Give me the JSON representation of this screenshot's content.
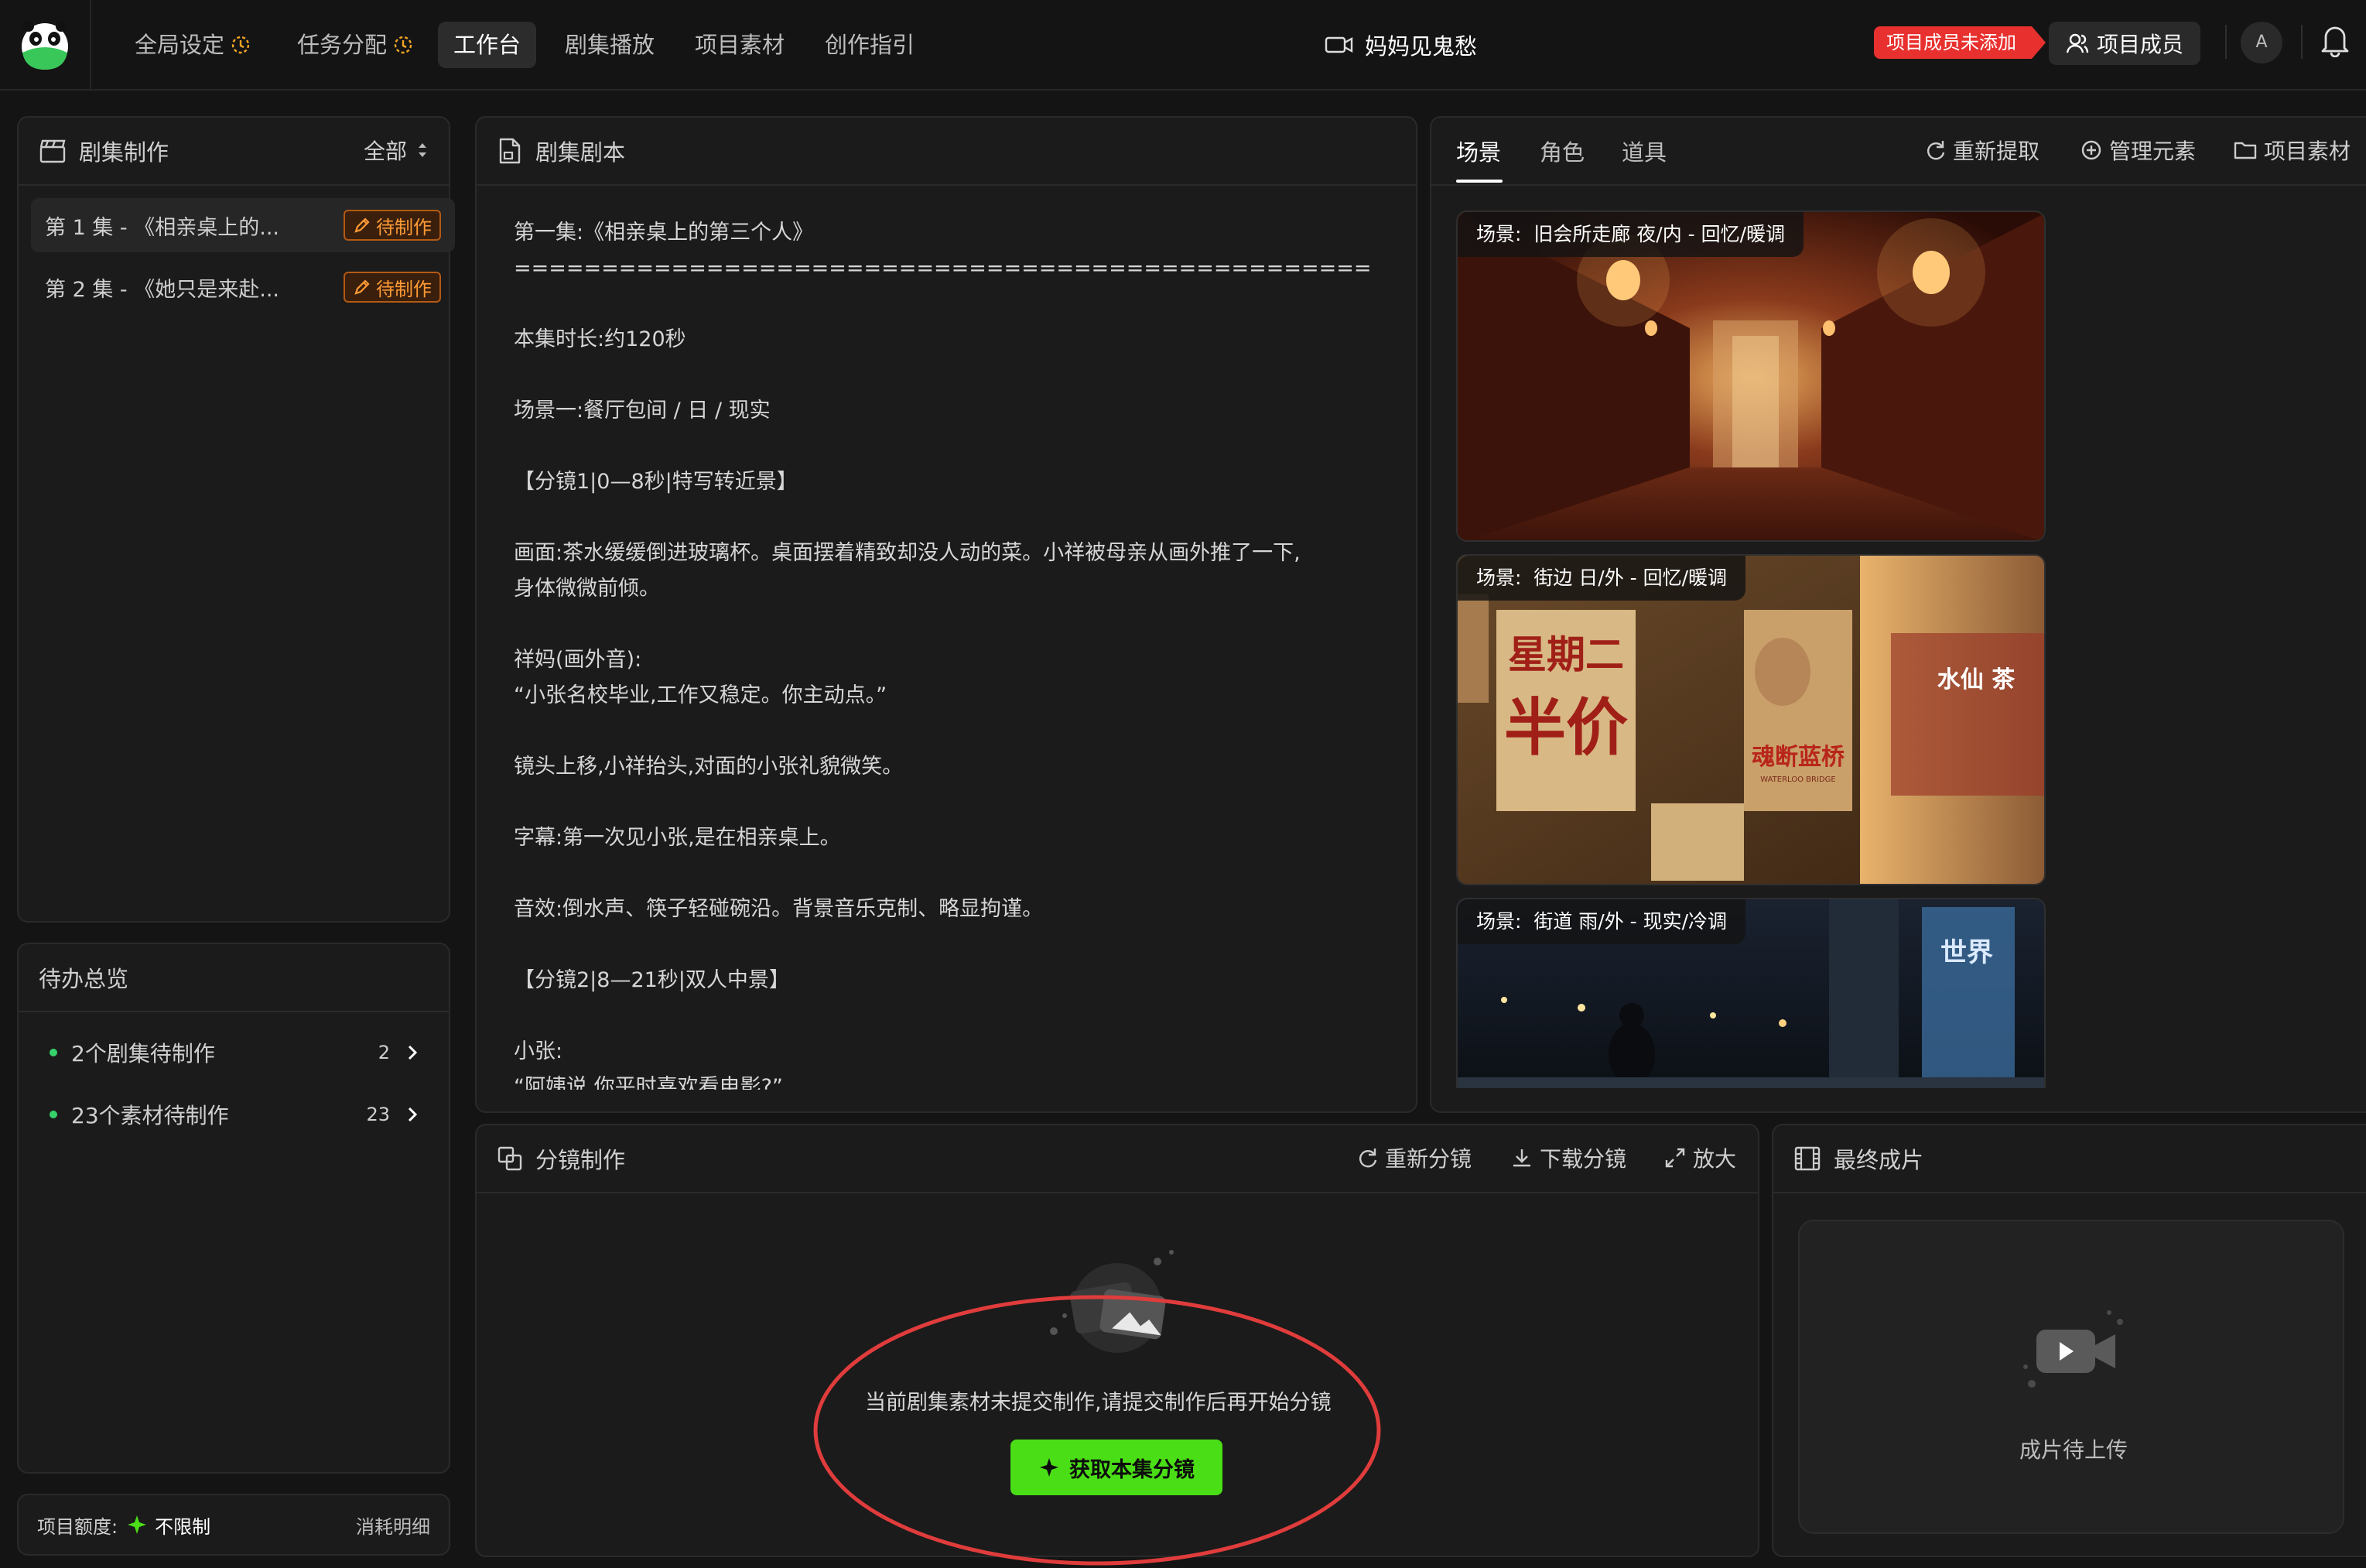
{
  "nav": {
    "items": [
      {
        "label": "全局设定",
        "has_clock": true
      },
      {
        "label": "任务分配",
        "has_clock": true
      },
      {
        "label": "工作台",
        "has_clock": false,
        "active": true
      },
      {
        "label": "剧集播放",
        "has_clock": false
      },
      {
        "label": "项目素材",
        "has_clock": false
      },
      {
        "label": "创作指引",
        "has_clock": false
      }
    ],
    "project_title": "妈妈见鬼愁",
    "member_warning": "项目成员未添加",
    "members_button": "项目成员",
    "avatar_letter": "A",
    "accent_color": "#4ade16"
  },
  "episodes": {
    "title": "剧集制作",
    "filter": "全部",
    "items": [
      {
        "label": "第 1 集 - 《相亲桌上的...",
        "status": "待制作",
        "active": true
      },
      {
        "label": "第 2 集 - 《她只是来赴...",
        "status": "待制作",
        "active": false
      }
    ]
  },
  "todo": {
    "title": "待办总览",
    "items": [
      {
        "label": "2个剧集待制作",
        "count": "2"
      },
      {
        "label": "23个素材待制作",
        "count": "23"
      }
    ]
  },
  "quota": {
    "label": "项目额度:",
    "value": "不限制",
    "detail": "消耗明细"
  },
  "script": {
    "title": "剧集剧本",
    "lines": [
      "第一集:《相亲桌上的第三个人》\n=================================================",
      "本集时长:约120秒",
      "场景一:餐厅包间 / 日 / 现实",
      "【分镜1|0—8秒|特写转近景】",
      "画面:茶水缓缓倒进玻璃杯。桌面摆着精致却没人动的菜。小祥被母亲从画外推了一下,\n身体微微前倾。",
      "祥妈(画外音):\n“小张名校毕业,工作又稳定。你主动点。”",
      "镜头上移,小祥抬头,对面的小张礼貌微笑。",
      "字幕:第一次见小张,是在相亲桌上。",
      "音效:倒水声、筷子轻碰碗沿。背景音乐克制、略显拘谨。",
      "【分镜2|8—21秒|双人中景】",
      "小张:\n“阿姨说,你平时喜欢看电影?”"
    ]
  },
  "assets": {
    "tabs": [
      "场景",
      "角色",
      "道具"
    ],
    "actions": [
      "重新提取",
      "管理元素",
      "项目素材"
    ],
    "scenes": [
      {
        "prefix": "场景:",
        "name": "旧会所走廊 夜/内 - 回忆/暖调"
      },
      {
        "prefix": "场景:",
        "name": "街边 日/外 - 回忆/暖调"
      },
      {
        "prefix": "场景:",
        "name": "街道 雨/外 - 现实/冷调"
      }
    ],
    "poster_text": {
      "sign_weekday": "星期二",
      "sign_half_price": "半价",
      "film_title": "魂断蓝桥",
      "film_subtitle": "WATERLOO BRIDGE",
      "shop_sign": "水仙 茶",
      "billboard": "世界"
    }
  },
  "storyboard": {
    "title": "分镜制作",
    "actions": [
      "重新分镜",
      "下载分镜",
      "放大"
    ],
    "empty_text": "当前剧集素材未提交制作,请提交制作后再开始分镜",
    "button_label": "获取本集分镜"
  },
  "final": {
    "title": "最终成片",
    "placeholder": "成片待上传"
  }
}
